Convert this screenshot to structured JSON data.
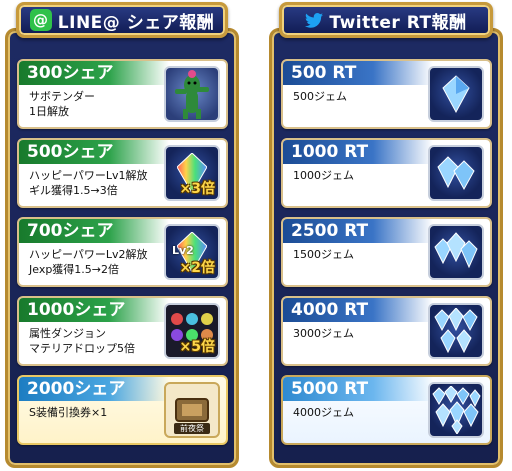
{
  "line": {
    "title": "LINE@ シェア報酬",
    "icon": "line-at-icon",
    "cards": [
      {
        "title": "300シェア",
        "desc": "サボテンダー\n1日解放",
        "icon": "cactuar-icon"
      },
      {
        "title": "500シェア",
        "desc": "ハッピーパワーLv1解放\nギル獲得1.5→3倍",
        "icon": "rainbow-crystal-gil-icon",
        "mult": "×3倍"
      },
      {
        "title": "700シェア",
        "desc": "ハッピーパワーLv2解放\nJexp獲得1.5→2倍",
        "icon": "rainbow-crystal-jexp-icon",
        "mult": "×2倍",
        "lv": "Lv2"
      },
      {
        "title": "1000シェア",
        "desc": "属性ダンジョン\nマテリアドロップ5倍",
        "icon": "materia-orbs-icon",
        "mult": "×5倍"
      },
      {
        "title": "2000シェア",
        "desc": "S装備引換券×1",
        "icon": "equipment-ticket-icon",
        "tag": "前夜祭"
      }
    ]
  },
  "twitter": {
    "title": "Twitter RT報酬",
    "icon": "twitter-bird-icon",
    "cards": [
      {
        "title": "500 RT",
        "desc": "500ジェム",
        "icon": "gem-icon",
        "count": 1
      },
      {
        "title": "1000 RT",
        "desc": "1000ジェム",
        "icon": "gems-icon",
        "count": 2
      },
      {
        "title": "2500 RT",
        "desc": "1500ジェム",
        "icon": "gems-icon",
        "count": 3
      },
      {
        "title": "4000 RT",
        "desc": "3000ジェム",
        "icon": "gems-icon",
        "count": 5
      },
      {
        "title": "5000 RT",
        "desc": "4000ジェム",
        "icon": "gems-icon",
        "count": 8
      }
    ]
  },
  "colors": {
    "panel": "#1a2558",
    "frame": "#c79a3c",
    "line_green": "#2fc14a",
    "twitter_blue": "#1da1f2",
    "gold_text": "#ffd84a"
  }
}
